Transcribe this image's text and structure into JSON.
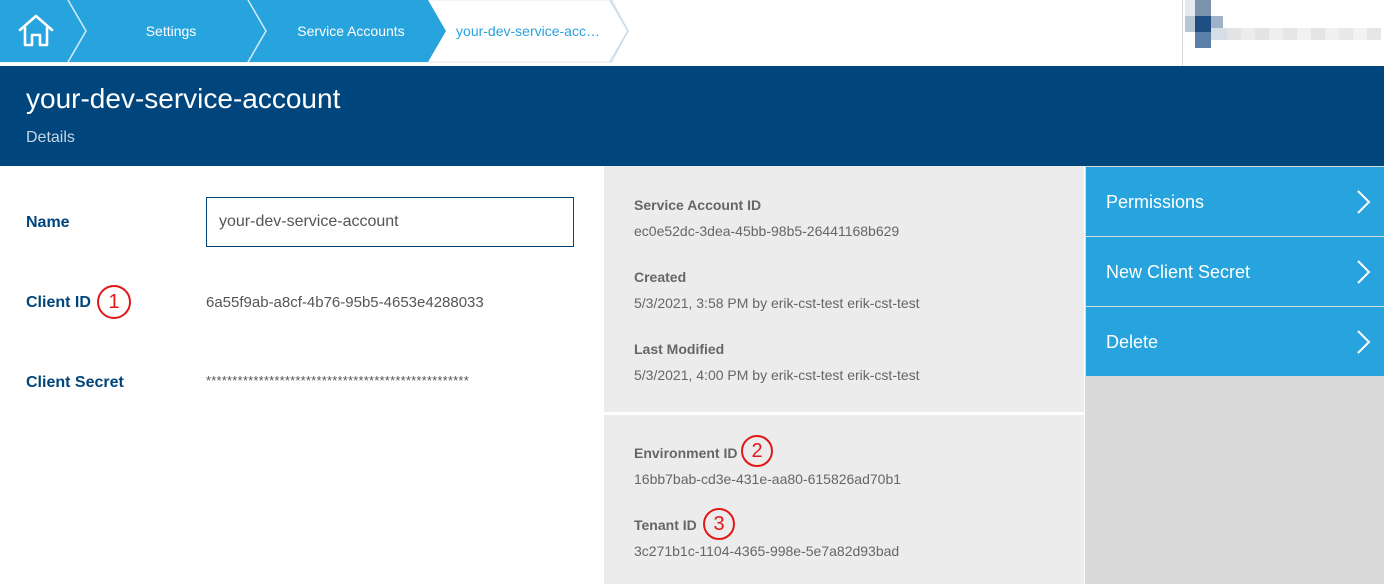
{
  "breadcrumb": {
    "home_icon": "home-icon",
    "items": [
      {
        "label": "Settings"
      },
      {
        "label": "Service Accounts"
      },
      {
        "label": "your-dev-service-acc…"
      }
    ]
  },
  "header": {
    "title": "your-dev-service-account",
    "subtitle": "Details"
  },
  "form": {
    "name_label": "Name",
    "name_value": "your-dev-service-account",
    "client_id_label": "Client ID",
    "client_id_value": "6a55f9ab-a8cf-4b76-95b5-4653e4288033",
    "client_secret_label": "Client Secret",
    "client_secret_value": "**************************************************"
  },
  "info": {
    "service_account_id_label": "Service Account ID",
    "service_account_id_value": "ec0e52dc-3dea-45bb-98b5-26441168b629",
    "created_label": "Created",
    "created_value": "5/3/2021, 3:58 PM by erik-cst-test erik-cst-test",
    "last_modified_label": "Last Modified",
    "last_modified_value": "5/3/2021, 4:00 PM by erik-cst-test erik-cst-test",
    "environment_id_label": "Environment ID",
    "environment_id_value": "16bb7bab-cd3e-431e-aa80-615826ad70b1",
    "tenant_id_label": "Tenant ID",
    "tenant_id_value": "3c271b1c-1104-4365-998e-5e7a82d93bad"
  },
  "annotations": [
    "1",
    "2",
    "3"
  ],
  "actions": [
    {
      "label": "Permissions"
    },
    {
      "label": "New Client Secret"
    },
    {
      "label": "Delete"
    }
  ],
  "colors": {
    "breadcrumb_blue": "#27a3dd",
    "header_navy": "#00457c",
    "label_navy": "#00457c",
    "action_blue": "#27a3dd",
    "annotation_red": "#e01818",
    "panel_gray": "#ececec"
  }
}
